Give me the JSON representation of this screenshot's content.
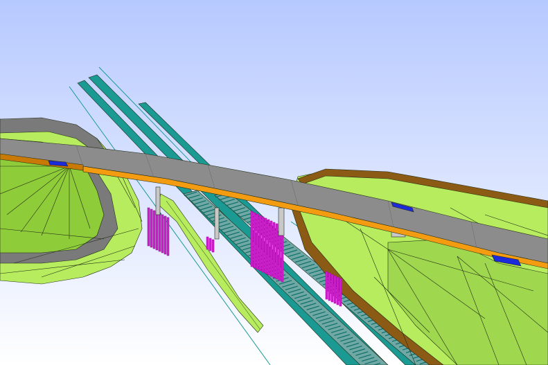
{
  "viewport": {
    "sky_top": "#b6c9ff",
    "sky_bottom": "#ffffff"
  },
  "colors": {
    "terrain": "#b6ec5e",
    "terrain_dark": "#8fcc3a",
    "terrain_shade": "#9fd84e",
    "mesh_line": "#1f2a14",
    "deck": "#8c8c8c",
    "deck_dark": "#6e6e6e",
    "girder": "#f39c12",
    "girder_dark": "#c97a06",
    "track": "#1a9a93",
    "track_dark": "#0b6e68",
    "sleeper": "#6fa8a4",
    "pile": "#d01fd0",
    "pile_dark": "#8e0e8e",
    "retaining_wall": "#8b5a14",
    "bearing": "#1b2bdc",
    "pier": "#c8c8c8",
    "road_surface": "#7a7a7a"
  },
  "model": {
    "objects": [
      {
        "name": "overpass-bridge-deck"
      },
      {
        "name": "left-embankment"
      },
      {
        "name": "right-embankment"
      },
      {
        "name": "railway-tracks"
      },
      {
        "name": "foundation-piles"
      },
      {
        "name": "retaining-wall"
      },
      {
        "name": "access-road"
      }
    ]
  }
}
